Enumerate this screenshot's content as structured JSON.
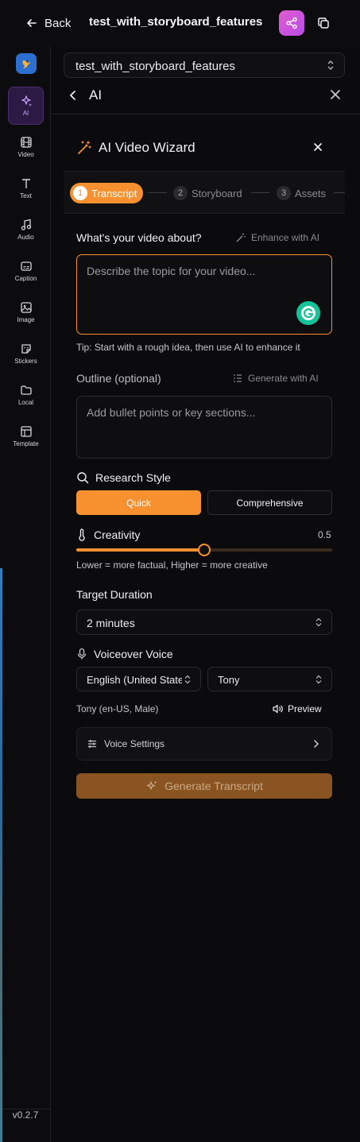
{
  "header": {
    "back_label": "Back",
    "project_title": "test_with_storyboard_features",
    "share_color": "#d65bd8"
  },
  "sidebar": {
    "items": [
      {
        "label": "AI",
        "icon": "sparkles-icon",
        "active": true
      },
      {
        "label": "Video",
        "icon": "film-icon"
      },
      {
        "label": "Text",
        "icon": "text-icon"
      },
      {
        "label": "Audio",
        "icon": "music-icon"
      },
      {
        "label": "Caption",
        "icon": "caption-icon"
      },
      {
        "label": "Image",
        "icon": "image-icon"
      },
      {
        "label": "Stickers",
        "icon": "sticker-icon"
      },
      {
        "label": "Local",
        "icon": "folder-icon"
      },
      {
        "label": "Template",
        "icon": "template-icon"
      }
    ],
    "version": "v0.2.7"
  },
  "panel": {
    "project_select_value": "test_with_storyboard_features",
    "section_title": "AI"
  },
  "wizard": {
    "title": "AI Video Wizard",
    "steps": [
      {
        "num": "1",
        "label": "Transcript",
        "active": true
      },
      {
        "num": "2",
        "label": "Storyboard"
      },
      {
        "num": "3",
        "label": "Assets"
      }
    ],
    "topic": {
      "label": "What's your video about?",
      "enhance_label": "Enhance with AI",
      "placeholder": "Describe the topic for your video...",
      "tip": "Tip: Start with a rough idea, then use AI to enhance it"
    },
    "outline": {
      "label": "Outline (optional)",
      "generate_label": "Generate with AI",
      "placeholder": "Add bullet points or key sections..."
    },
    "research": {
      "label": "Research Style",
      "options": [
        "Quick",
        "Comprehensive"
      ],
      "selected": "Quick"
    },
    "creativity": {
      "label": "Creativity",
      "value": "0.5",
      "level": 0.5,
      "hint": "Lower = more factual, Higher = more creative"
    },
    "duration": {
      "label": "Target Duration",
      "value": "2 minutes"
    },
    "voice": {
      "label": "Voiceover Voice",
      "language": "English (United States)",
      "voice": "Tony",
      "meta": "Tony (en-US, Male)",
      "preview_label": "Preview",
      "settings_label": "Voice Settings"
    },
    "generate_label": "Generate Transcript",
    "accent_color": "#f7902e"
  }
}
